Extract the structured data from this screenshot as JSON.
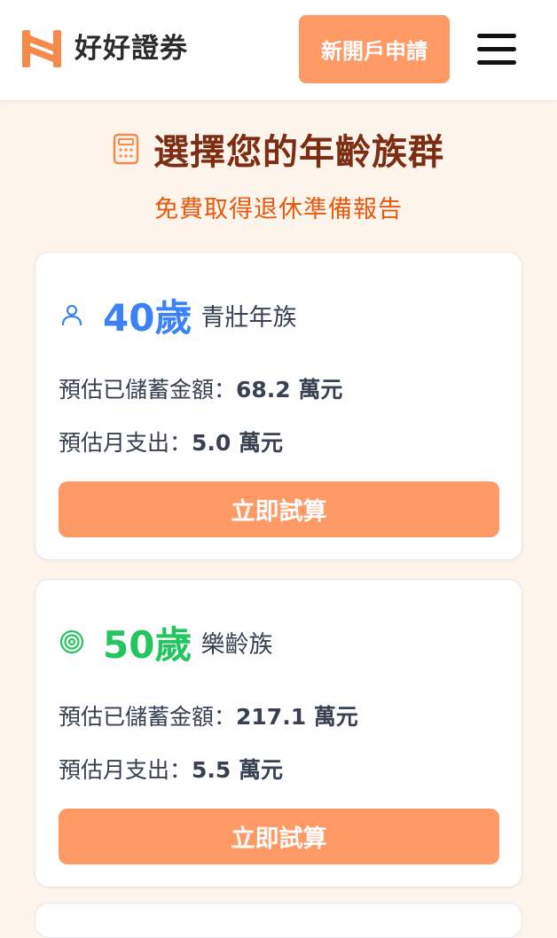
{
  "header": {
    "brand": "好好證券",
    "cta_label": "新開戶申請",
    "logo_icon": "brand-logo-icon",
    "menu_icon": "hamburger-menu-icon",
    "accent_color": "#ff9966"
  },
  "hero": {
    "title": "選擇您的年齡族群",
    "subtitle": "免費取得退休準備報告",
    "icon": "calculator-icon"
  },
  "cards": [
    {
      "age": "40歲",
      "group": "青壯年族",
      "icon": "user-icon",
      "age_color": "#3b82f6",
      "savings_label": "預估已儲蓄金額：",
      "savings_value": "68.2 萬元",
      "expense_label": "預估月支出：",
      "expense_value": "5.0 萬元",
      "button_label": "立即試算"
    },
    {
      "age": "50歲",
      "group": "樂齡族",
      "icon": "target-icon",
      "age_color": "#22c55e",
      "savings_label": "預估已儲蓄金額：",
      "savings_value": "217.1 萬元",
      "expense_label": "預估月支出：",
      "expense_value": "5.5 萬元",
      "button_label": "立即試算"
    }
  ]
}
